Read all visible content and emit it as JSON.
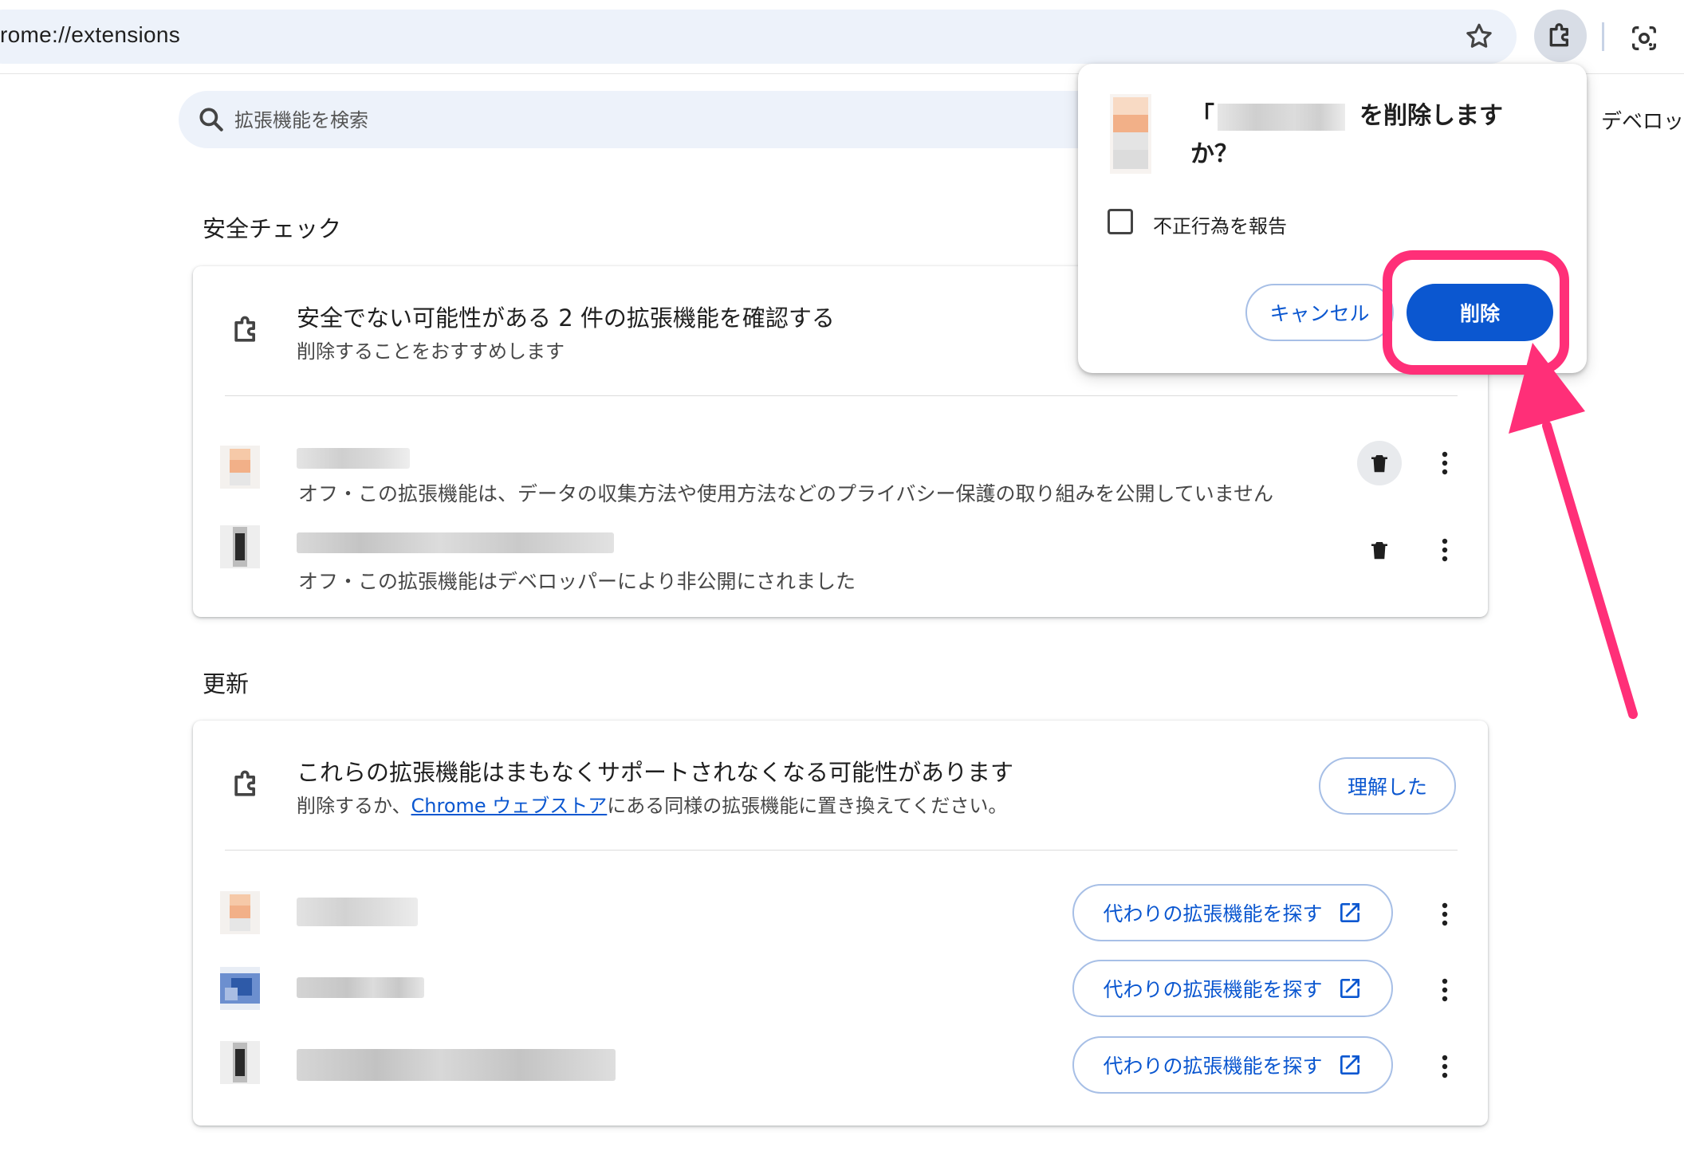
{
  "browser": {
    "url": "rome://extensions",
    "icons": [
      "star-icon",
      "extensions-puzzle-icon",
      "lens-icon"
    ]
  },
  "search": {
    "placeholder": "拡張機能を検索"
  },
  "header": {
    "developer_mode_label": "デベロッ"
  },
  "safety_check": {
    "section_title": "安全チェック",
    "title": "安全でない可能性がある 2 件の拡張機能を確認する",
    "subtitle": "削除することをおすすめします",
    "items": [
      {
        "description": "オフ・この拡張機能は、データの収集方法や使用方法などのプライバシー保護の取り組みを公開していません"
      },
      {
        "description": "オフ・この拡張機能はデベロッパーにより非公開にされました"
      }
    ]
  },
  "updates": {
    "section_title": "更新",
    "title": "これらの拡張機能はまもなくサポートされなくなる可能性があります",
    "subtitle_pre": "削除するか、",
    "subtitle_link": "Chrome ウェブストア",
    "subtitle_post": "にある同様の拡張機能に置き換えてください。",
    "ack_button": "理解した",
    "items": [
      {
        "button": "代わりの拡張機能を探す"
      },
      {
        "button": "代わりの拡張機能を探す"
      },
      {
        "button": "代わりの拡張機能を探す"
      }
    ]
  },
  "dialog": {
    "title_prefix": "「",
    "title_suffix": "を削除します",
    "title_line2": "か？",
    "checkbox_label": "不正行為を報告",
    "checkbox_checked": false,
    "cancel": "キャンセル",
    "delete": "削除"
  },
  "colors": {
    "accent": "#0b57d0",
    "annotation": "#ff2f78",
    "omnibox_bg": "#edf2fa"
  }
}
